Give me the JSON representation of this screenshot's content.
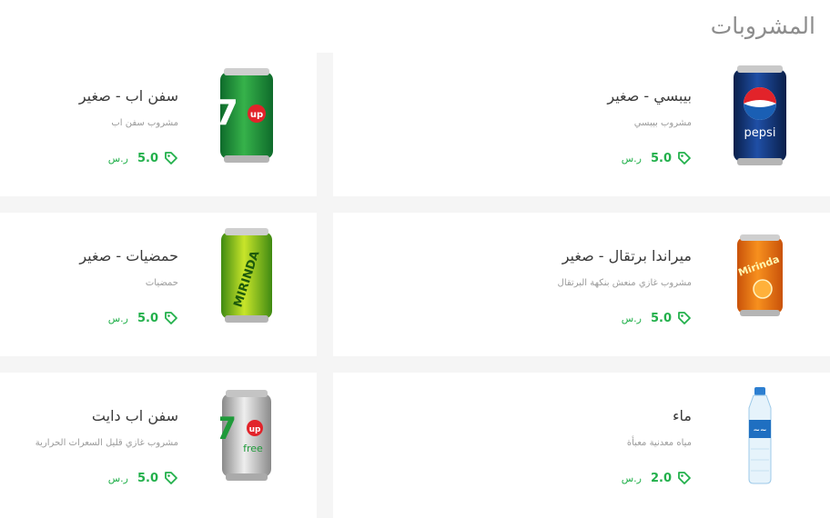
{
  "section": {
    "title": "المشروبات"
  },
  "products": [
    {
      "name": "بيبسي - صغير",
      "desc": "مشروب بيبسي",
      "price": "5.0",
      "currency": "ر.س",
      "image": "pepsi-can-icon"
    },
    {
      "name": "سفن اب - صغير",
      "desc": "مشروب سفن اب",
      "price": "5.0",
      "currency": "ر.س",
      "image": "7up-can-icon"
    },
    {
      "name": "ميراندا برتقال - صغير",
      "desc": "مشروب غازي منعش بنكهة البرتقال",
      "price": "5.0",
      "currency": "ر.س",
      "image": "mirinda-orange-can-icon"
    },
    {
      "name": "حمضيات - صغير",
      "desc": "حمضيات",
      "price": "5.0",
      "currency": "ر.س",
      "image": "mirinda-citrus-can-icon"
    },
    {
      "name": "ماء",
      "desc": "مياه معدنية معبأة",
      "price": "2.0",
      "currency": "ر.س",
      "image": "water-bottle-icon"
    },
    {
      "name": "سفن اب دايت",
      "desc": "مشروب غازي قليل السعرات الحرارية",
      "price": "5.0",
      "currency": "ر.س",
      "image": "7up-free-can-icon"
    }
  ],
  "colors": {
    "price": "#22b04b",
    "title": "#8d8d8d",
    "background": "#f5f5f5"
  }
}
